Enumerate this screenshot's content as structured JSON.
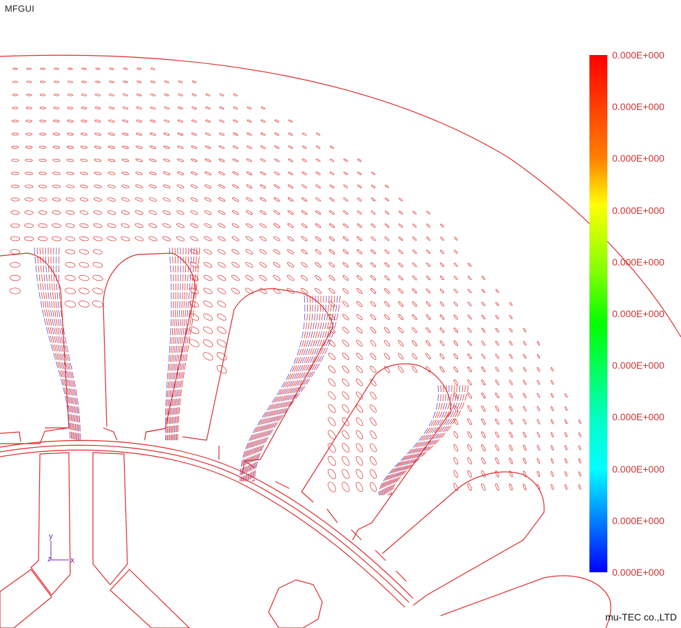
{
  "app": {
    "title": "MFGUI"
  },
  "legend": {
    "labels": [
      "0.000E+000",
      "0.000E+000",
      "0.000E+000",
      "0.000E+000",
      "0.000E+000",
      "0.000E+000",
      "0.000E+000",
      "0.000E+000",
      "0.000E+000",
      "0.000E+000",
      "0.000E+000"
    ],
    "colors": {
      "top": "#ff0000",
      "bottom": "#0000ff"
    }
  },
  "axes": {
    "x": "x",
    "y": "y",
    "z": "z"
  },
  "footer": {
    "company": "mu-TEC co.,LTD"
  },
  "colors": {
    "geometry": "#dd2a2a",
    "glyph_alt": "#4a4ae0",
    "axis": "#7a1fb0"
  }
}
